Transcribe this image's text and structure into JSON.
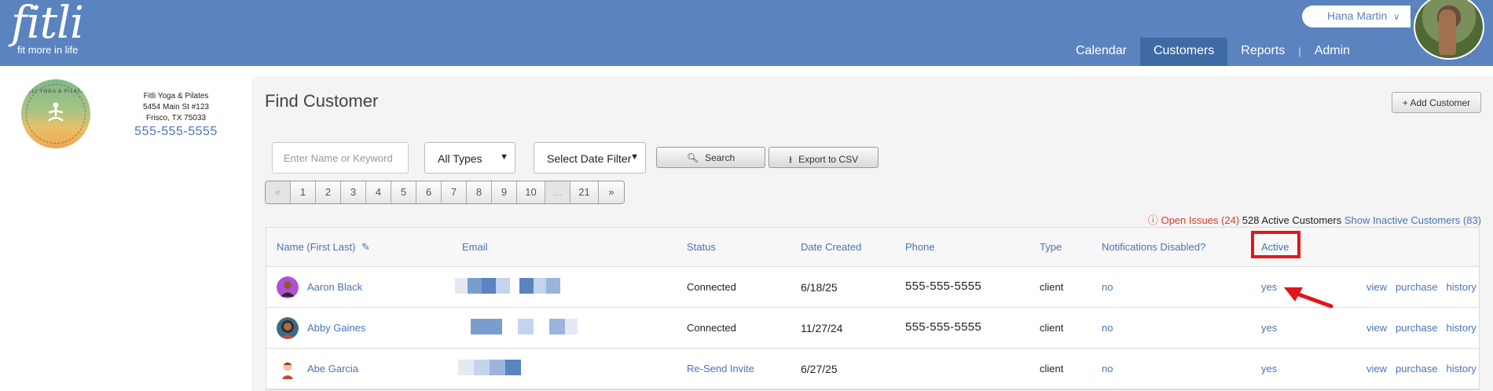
{
  "brand": {
    "name": "fitli",
    "tagline": "fit more in life",
    "header_color": "#5a83c0"
  },
  "user": {
    "name": "Hana Martin"
  },
  "nav": [
    {
      "label": "Calendar",
      "active": false
    },
    {
      "label": "Customers",
      "active": true
    },
    {
      "label": "Reports",
      "active": false
    },
    {
      "label": "Admin",
      "active": false
    }
  ],
  "venue": {
    "logo_text": "FITLI YOGA & PILATES",
    "name": "Fitli Yoga & Pilates",
    "address1": "5454 Main St #123",
    "address2": "Frisco, TX 75033",
    "phone": "555-555-5555"
  },
  "page": {
    "title": "Find Customer",
    "add_button": "+ Add Customer",
    "search_placeholder": "Enter Name or Keyword",
    "type_select": "All Types",
    "date_select": "Select Date Filter",
    "search_button": "Search",
    "export_button": "Export to CSV"
  },
  "pager": [
    "«",
    "1",
    "2",
    "3",
    "4",
    "5",
    "6",
    "7",
    "8",
    "9",
    "10",
    "...",
    "21",
    "»"
  ],
  "summary": {
    "issues": "Open Issues (24)",
    "active_count": "528 Active Customers",
    "inactive_link": "Show Inactive Customers (83)"
  },
  "columns": {
    "name": "Name (First Last)",
    "email": "Email",
    "status": "Status",
    "date_created": "Date Created",
    "phone": "Phone",
    "type": "Type",
    "notifications": "Notifications Disabled?",
    "active": "Active"
  },
  "rows": [
    {
      "name": "Aaron Black",
      "status": "Connected",
      "date": "6/18/25",
      "phone": "555-555-5555",
      "type": "client",
      "notif": "no",
      "active": "yes"
    },
    {
      "name": "Abby Gaines",
      "status": "Connected",
      "date": "11/27/24",
      "phone": "555-555-5555",
      "type": "client",
      "notif": "no",
      "active": "yes"
    },
    {
      "name": "Abe Garcia",
      "status": "Re-Send Invite",
      "date": "6/27/25",
      "phone": "",
      "type": "client",
      "notif": "no",
      "active": "yes"
    }
  ],
  "row_actions": [
    "view",
    "purchase",
    "history"
  ],
  "icons": {
    "search": "magnifier-icon",
    "export": "download-icon",
    "edit": "pencil-icon",
    "issues": "alert-circle-icon"
  },
  "annotation_color": "#e3161b"
}
